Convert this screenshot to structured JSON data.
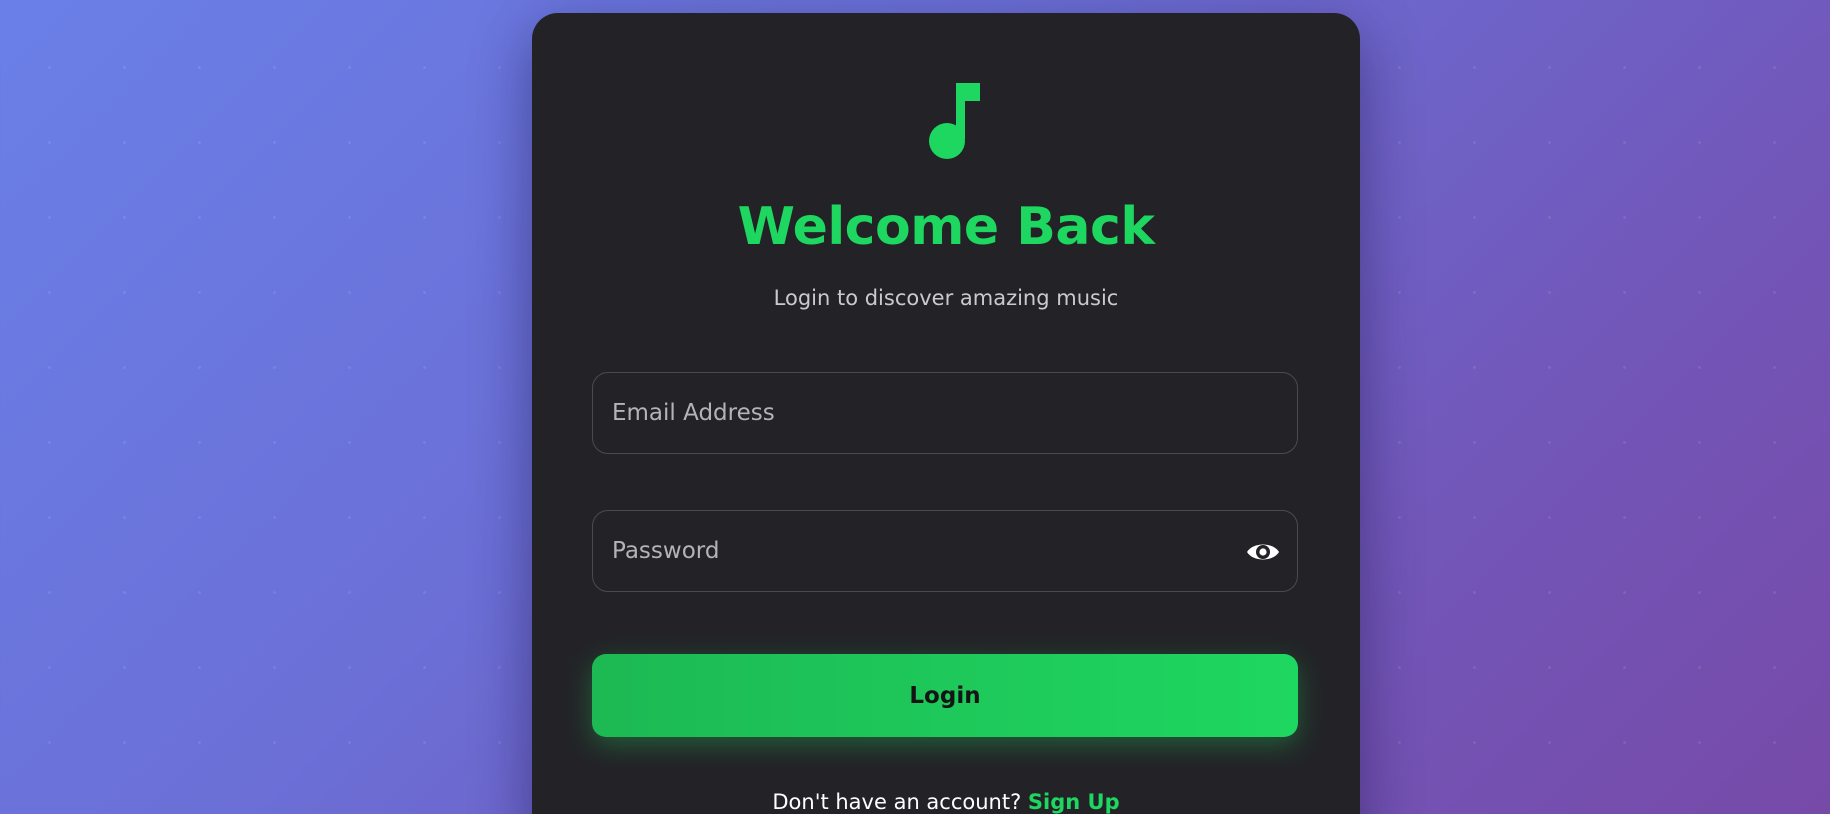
{
  "brand": {
    "accent_color": "#1ed760",
    "logo_icon": "music-note-icon"
  },
  "header": {
    "title": "Welcome Back",
    "subtitle": "Login to discover amazing music"
  },
  "form": {
    "email_placeholder": "Email Address",
    "email_value": "",
    "password_placeholder": "Password",
    "password_value": "",
    "toggle_icon": "eye-icon",
    "submit_label": "Login"
  },
  "footer": {
    "prompt": "Don't have an account?",
    "signup_label": "Sign Up"
  }
}
